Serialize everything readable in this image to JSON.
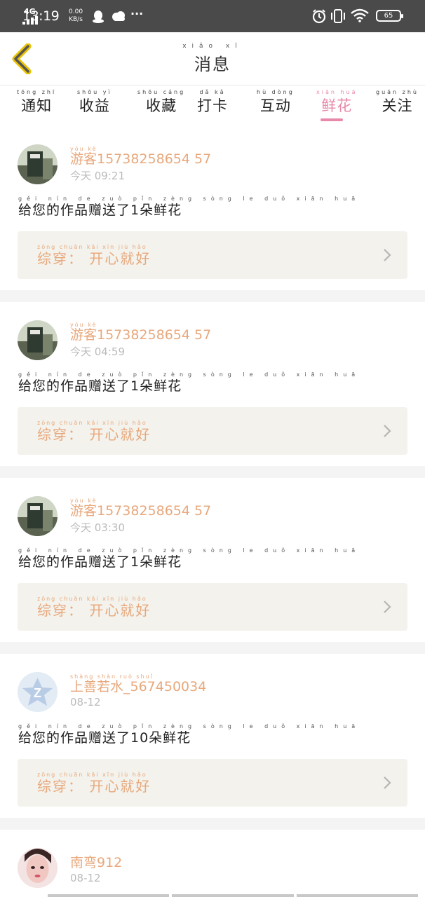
{
  "status_bar": {
    "network": "4G",
    "time": "13:19",
    "speed_value": "0.00",
    "speed_unit": "KB/s",
    "more": "···",
    "battery": "65"
  },
  "header": {
    "back_icon": "chevron-left-icon",
    "title_pinyin": "xiǎo xī",
    "title": "消息"
  },
  "tabs": [
    {
      "pinyin": "tōng zhī",
      "label": "通知",
      "active": false
    },
    {
      "pinyin": "shōu yì",
      "label": "收益",
      "active": false
    },
    {
      "pinyin": "shōu cáng",
      "label": "收藏",
      "active": false
    },
    {
      "pinyin": "dǎ kǎ",
      "label": "打卡",
      "active": false
    },
    {
      "pinyin": "hù dòng",
      "label": "互动",
      "active": false
    },
    {
      "pinyin": "xiān huā",
      "label": "鲜花",
      "active": true
    },
    {
      "pinyin": "guān zhù",
      "label": "关注",
      "active": false
    }
  ],
  "messages": [
    {
      "avatar": "landscape-photo",
      "user_pinyin": "yóu kè",
      "user": "游客15738258654 57",
      "time": "今天 09:21",
      "text_pinyin": "gěi nín de zuò pǐn zèng sòng le duǒ xiān huā",
      "text": "给您的作品赠送了1朵鲜花",
      "work_pinyin": "zōng chuān   kāi xīn jiù hǎo",
      "work_label": "综穿： 开心就好"
    },
    {
      "avatar": "landscape-photo",
      "user_pinyin": "yóu kè",
      "user": "游客15738258654 57",
      "time": "今天 04:59",
      "text_pinyin": "gěi nín de zuò pǐn zèng sòng le duǒ xiān huā",
      "text": "给您的作品赠送了1朵鲜花",
      "work_pinyin": "zōng chuān   kāi xīn jiù hǎo",
      "work_label": "综穿： 开心就好"
    },
    {
      "avatar": "landscape-photo",
      "user_pinyin": "yóu kè",
      "user": "游客15738258654 57",
      "time": "今天 03:30",
      "text_pinyin": "gěi nín de zuò pǐn zèng sòng le duǒ xiān huā",
      "text": "给您的作品赠送了1朵鲜花",
      "work_pinyin": "zōng chuān   kāi xīn jiù hǎo",
      "work_label": "综穿： 开心就好"
    },
    {
      "avatar": "qzone-default-avatar",
      "user_pinyin": "shàng shàn ruò shuǐ",
      "user": "上善若水_567450034",
      "time": "08-12",
      "text_pinyin": "gěi nín de zuò pǐn zèng sòng le duǒ xiān huā",
      "text": "给您的作品赠送了10朵鲜花",
      "work_pinyin": "zōng chuān   kāi xīn jiù hǎo",
      "work_label": "综穿： 开心就好"
    },
    {
      "avatar": "portrait-photo",
      "user_pinyin": "",
      "user": "南弯912",
      "time": "08-12",
      "text_pinyin": "",
      "text": "",
      "work_pinyin": "",
      "work_label": ""
    }
  ]
}
